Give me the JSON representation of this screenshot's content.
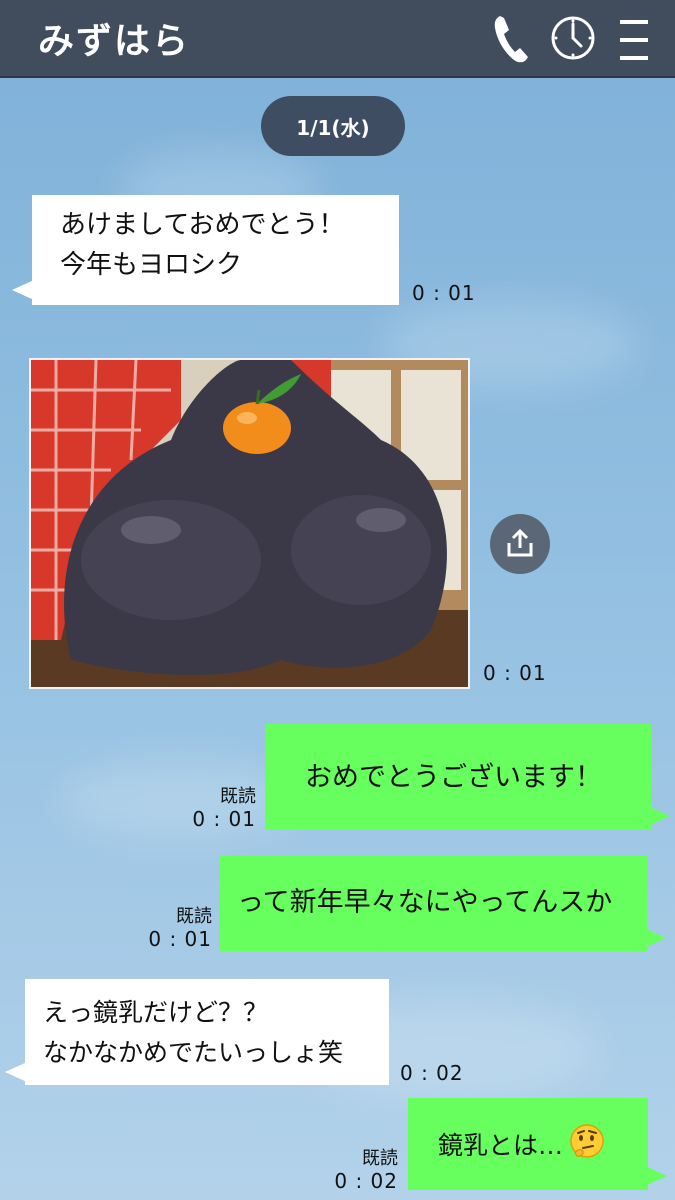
{
  "header": {
    "title": "みずはら",
    "icons": [
      "phone-icon",
      "clock-icon",
      "menu-icon"
    ]
  },
  "date_separator": "1/1(水)",
  "messages": [
    {
      "side": "left",
      "type": "text",
      "lines": [
        "あけましておめでとう！",
        "今年もヨロシク"
      ],
      "time": "0 : 01"
    },
    {
      "side": "left",
      "type": "image",
      "time": "0 : 01"
    },
    {
      "side": "right",
      "type": "text",
      "text": "おめでとうございます！",
      "read": "既読",
      "time": "0 : 01"
    },
    {
      "side": "right",
      "type": "text",
      "text": "って新年早々なにやってんスか",
      "read": "既読",
      "time": "0 : 01"
    },
    {
      "side": "left",
      "type": "text",
      "lines": [
        "えっ鏡乳だけど？？",
        "なかなかめでたいっしょ笑"
      ],
      "time": "0 : 02"
    },
    {
      "side": "right",
      "type": "text",
      "text": "鏡乳とは…",
      "emoji": "thinking-face-icon",
      "read": "既読",
      "time": "0 : 02"
    }
  ],
  "colors": {
    "header": "#414c5d",
    "outgoing_bubble": "#66ff5e",
    "incoming_bubble": "#ffffff",
    "date_pill": "#3f4d62"
  }
}
